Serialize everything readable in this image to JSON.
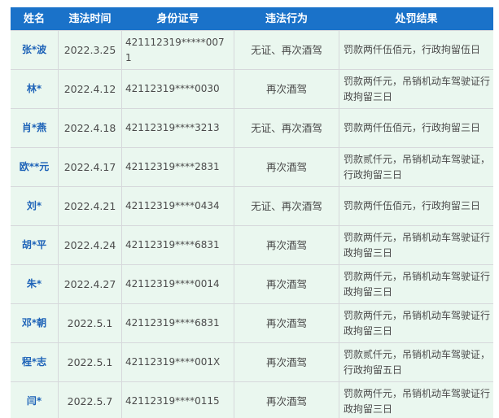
{
  "table": {
    "headers": {
      "name": "姓名",
      "date": "违法时间",
      "id": "身份证号",
      "act": "违法行为",
      "penalty": "处罚结果"
    },
    "rows": [
      {
        "name": "张*波",
        "date": "2022.3.25",
        "id": "421112319*****0071",
        "act": "无证、再次酒驾",
        "penalty": "罚款两仟伍佰元，行政拘留伍日"
      },
      {
        "name": "林*",
        "date": "2022.4.12",
        "id": "42112319****0030",
        "act": "再次酒驾",
        "penalty": "罚款两仟元，吊销机动车驾驶证行政拘留三日"
      },
      {
        "name": "肖*燕",
        "date": "2022.4.18",
        "id": "42112319****3213",
        "act": "无证、再次酒驾",
        "penalty": "罚款两仟伍佰元，行政拘留三日"
      },
      {
        "name": "欧**元",
        "date": "2022.4.17",
        "id": "42112319****2831",
        "act": "再次酒驾",
        "penalty": "罚款贰仟元，吊销机动车驾驶证，行政拘留三日"
      },
      {
        "name": "刘*",
        "date": "2022.4.21",
        "id": "42112319****0434",
        "act": "无证、再次酒驾",
        "penalty": "罚款两仟伍佰元，行政拘留三日"
      },
      {
        "name": "胡*平",
        "date": "2022.4.24",
        "id": "42112319****6831",
        "act": "再次酒驾",
        "penalty": "罚款两仟元，吊销机动车驾驶证行政拘留三日"
      },
      {
        "name": "朱*",
        "date": "2022.4.27",
        "id": "42112319****0014",
        "act": "再次酒驾",
        "penalty": "罚款两仟元，吊销机动车驾驶证行政拘留三日"
      },
      {
        "name": "邓*朝",
        "date": "2022.5.1",
        "id": "42112319****6831",
        "act": "再次酒驾",
        "penalty": "罚款两仟元，吊销机动车驾驶证行政拘留三日"
      },
      {
        "name": "程*志",
        "date": "2022.5.1",
        "id": "42112319****001X",
        "act": "再次酒驾",
        "penalty": "罚款贰仟元，吊销机动车驾驶证，行政拘留五日"
      },
      {
        "name": "闫*",
        "date": "2022.5.7",
        "id": "42112319****0115",
        "act": "再次酒驾",
        "penalty": "罚款两仟元，吊销机动车驾驶证行政拘留三日"
      }
    ]
  }
}
